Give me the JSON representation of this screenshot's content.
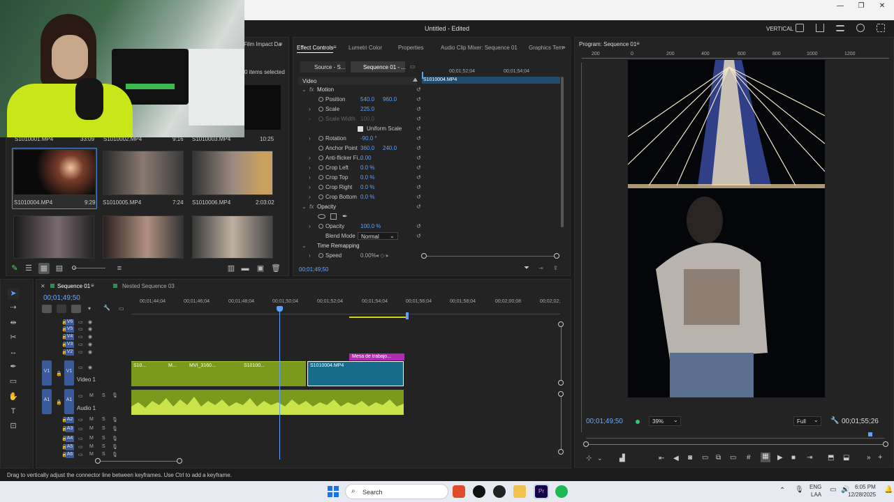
{
  "app": {
    "title": "Untitled - Edited",
    "layout_label": "VERTICAL"
  },
  "project": {
    "tab": "Film Impact Da",
    "items_selected": "0 items selected",
    "row0": [
      {
        "name": "S1010001.MP4",
        "dur": "33:09"
      },
      {
        "name": "S1010002.MP4",
        "dur": "9:16"
      },
      {
        "name": "S1010003.MP4",
        "dur": "10:25"
      }
    ],
    "row1": [
      {
        "name": "S1010004.MP4",
        "dur": "9:29"
      },
      {
        "name": "S1010005.MP4",
        "dur": "7:24"
      },
      {
        "name": "S1010006.MP4",
        "dur": "2:03:02"
      }
    ]
  },
  "effect_panel": {
    "tabs": [
      "Effect Controls",
      "Lumetri Color",
      "Properties",
      "Audio Clip Mixer: Sequence 01",
      "Graphics Tem"
    ],
    "source_tab": "Source - S...",
    "seq_tab": "Sequence 01 - ...",
    "ruler": [
      "00;01;52;04",
      "00;01;54;04"
    ],
    "clip_name": "S1010004.MP4",
    "section_video": "Video",
    "motion": "Motion",
    "rows": [
      {
        "label": "Position",
        "v1": "540.0",
        "v2": "960.0"
      },
      {
        "label": "Scale",
        "v1": "225.0",
        "v2": ""
      },
      {
        "label": "Scale Width",
        "v1": "100.0",
        "v2": ""
      },
      {
        "label": "Uniform Scale",
        "v1": "",
        "v2": ""
      },
      {
        "label": "Rotation",
        "v1": "-90.0 °",
        "v2": ""
      },
      {
        "label": "Anchor Point",
        "v1": "360.0",
        "v2": "240.0"
      },
      {
        "label": "Anti-flicker Fi...",
        "v1": "0.00",
        "v2": ""
      },
      {
        "label": "Crop Left",
        "v1": "0.0 %",
        "v2": ""
      },
      {
        "label": "Crop Top",
        "v1": "0.0 %",
        "v2": ""
      },
      {
        "label": "Crop Right",
        "v1": "0.0 %",
        "v2": ""
      },
      {
        "label": "Crop Bottom",
        "v1": "0.0 %",
        "v2": ""
      }
    ],
    "opacity_section": "Opacity",
    "opacity_label": "Opacity",
    "opacity_value": "100.0 %",
    "blend_label": "Blend Mode",
    "blend_value": "Normal",
    "time_remap": "Time Remapping",
    "speed_label": "Speed",
    "speed_value": "0.00%",
    "timecode": "00;01;49;50"
  },
  "program": {
    "title": "Program: Sequence 01",
    "ruler": [
      "200",
      "0",
      "200",
      "400",
      "600",
      "800",
      "1000",
      "1200"
    ],
    "timecode": "00;01;49;50",
    "zoom": "39%",
    "quality": "Full",
    "duration": "00;01;55;26"
  },
  "timeline": {
    "tabs": [
      "Sequence 01",
      "Nested Sequence 03"
    ],
    "timecode": "00;01;49;50",
    "ruler": [
      "00;01;44;04",
      "00;01;46;04",
      "00;01;48;04",
      "00;01;50;04",
      "00;01;52;04",
      "00;01;54;04",
      "00;01;56;04",
      "00;01;58;04",
      "00;02;00;08",
      "00;02;02;"
    ],
    "video_tracks": [
      "V6",
      "V5",
      "V4",
      "V3",
      "V2"
    ],
    "v1": "V1",
    "video1_name": "Video 1",
    "a1": "A1",
    "audio1_name": "Audio 1",
    "audio_tracks": [
      "A2",
      "A3",
      "A4",
      "A5",
      "A6"
    ],
    "clips": [
      "S10...",
      "M...",
      "MVI_3160...",
      "S10100...",
      "S1010004.MP4"
    ],
    "nested_label": "Mesa de trabajo..."
  },
  "status": {
    "hint": "Drag to vertically adjust the connector line between keyframes. Use Ctrl to add a keyframe."
  },
  "taskbar": {
    "search": "Search",
    "lang1": "ENG",
    "lang2": "LAA",
    "time": "6:05 PM",
    "date": "12/28/2025"
  }
}
